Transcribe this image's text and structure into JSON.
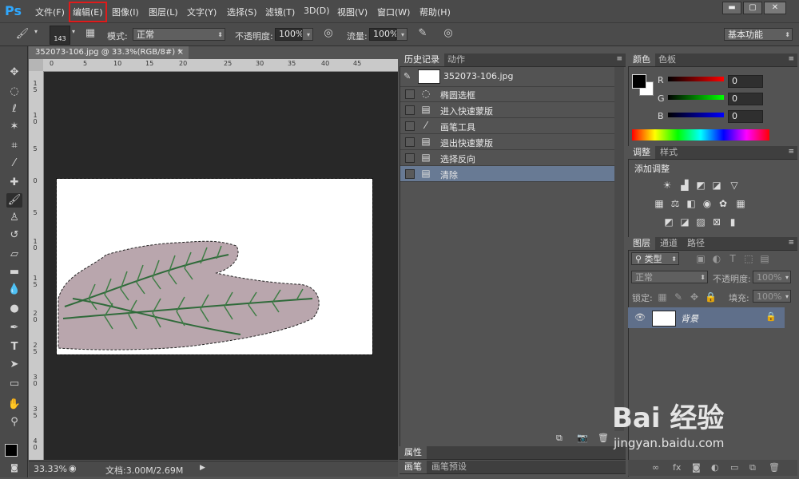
{
  "app": {
    "logo": "Ps"
  },
  "menu": [
    "文件(F)",
    "编辑(E)",
    "图像(I)",
    "图层(L)",
    "文字(Y)",
    "选择(S)",
    "滤镜(T)",
    "3D(D)",
    "视图(V)",
    "窗口(W)",
    "帮助(H)"
  ],
  "window_controls": {
    "min": "▬",
    "restore": "▢",
    "close": "✕"
  },
  "options": {
    "brush_size": "143",
    "mode_label": "模式:",
    "mode_value": "正常",
    "opacity_label": "不透明度:",
    "opacity_value": "100%",
    "flow_label": "流量:",
    "flow_value": "100%",
    "workspace": "基本功能"
  },
  "document": {
    "tab_title": "352073-106.jpg @ 33.3%(RGB/8#) *",
    "zoom": "33.33%",
    "doc_size": "文档:3.00M/2.69M",
    "ruler_h": [
      "0",
      "5",
      "10",
      "15",
      "20",
      "25",
      "30",
      "35",
      "40",
      "45"
    ],
    "ruler_v": [
      "1\n5",
      "1\n0",
      "5",
      "0",
      "5",
      "1\n0",
      "1\n5",
      "2\n0",
      "2\n5",
      "3\n0",
      "3\n5",
      "4\n0"
    ]
  },
  "history": {
    "tabs": [
      "历史记录",
      "动作"
    ],
    "snapshot": "352073-106.jpg",
    "items": [
      "椭圆选框",
      "进入快速蒙版",
      "画笔工具",
      "退出快速蒙版",
      "选择反向",
      "清除"
    ],
    "selected_index": 5
  },
  "properties": {
    "tab": "属性"
  },
  "bottom_tabs": [
    "画笔",
    "画笔预设"
  ],
  "color": {
    "tabs": [
      "颜色",
      "色板"
    ],
    "r_label": "R",
    "g_label": "G",
    "b_label": "B",
    "r": "0",
    "g": "0",
    "b": "0"
  },
  "adjust": {
    "tabs": [
      "调整",
      "样式"
    ],
    "title": "添加调整"
  },
  "layers": {
    "tabs": [
      "图层",
      "通道",
      "路径"
    ],
    "kind": "类型",
    "blend": "正常",
    "opacity_label": "不透明度:",
    "opacity_value": "100%",
    "lock_label": "锁定:",
    "fill_label": "填充:",
    "fill_value": "100%",
    "layer_name": "背景"
  },
  "watermark": {
    "logo": "Bai 经验",
    "url": "jingyan.baidu.com"
  }
}
